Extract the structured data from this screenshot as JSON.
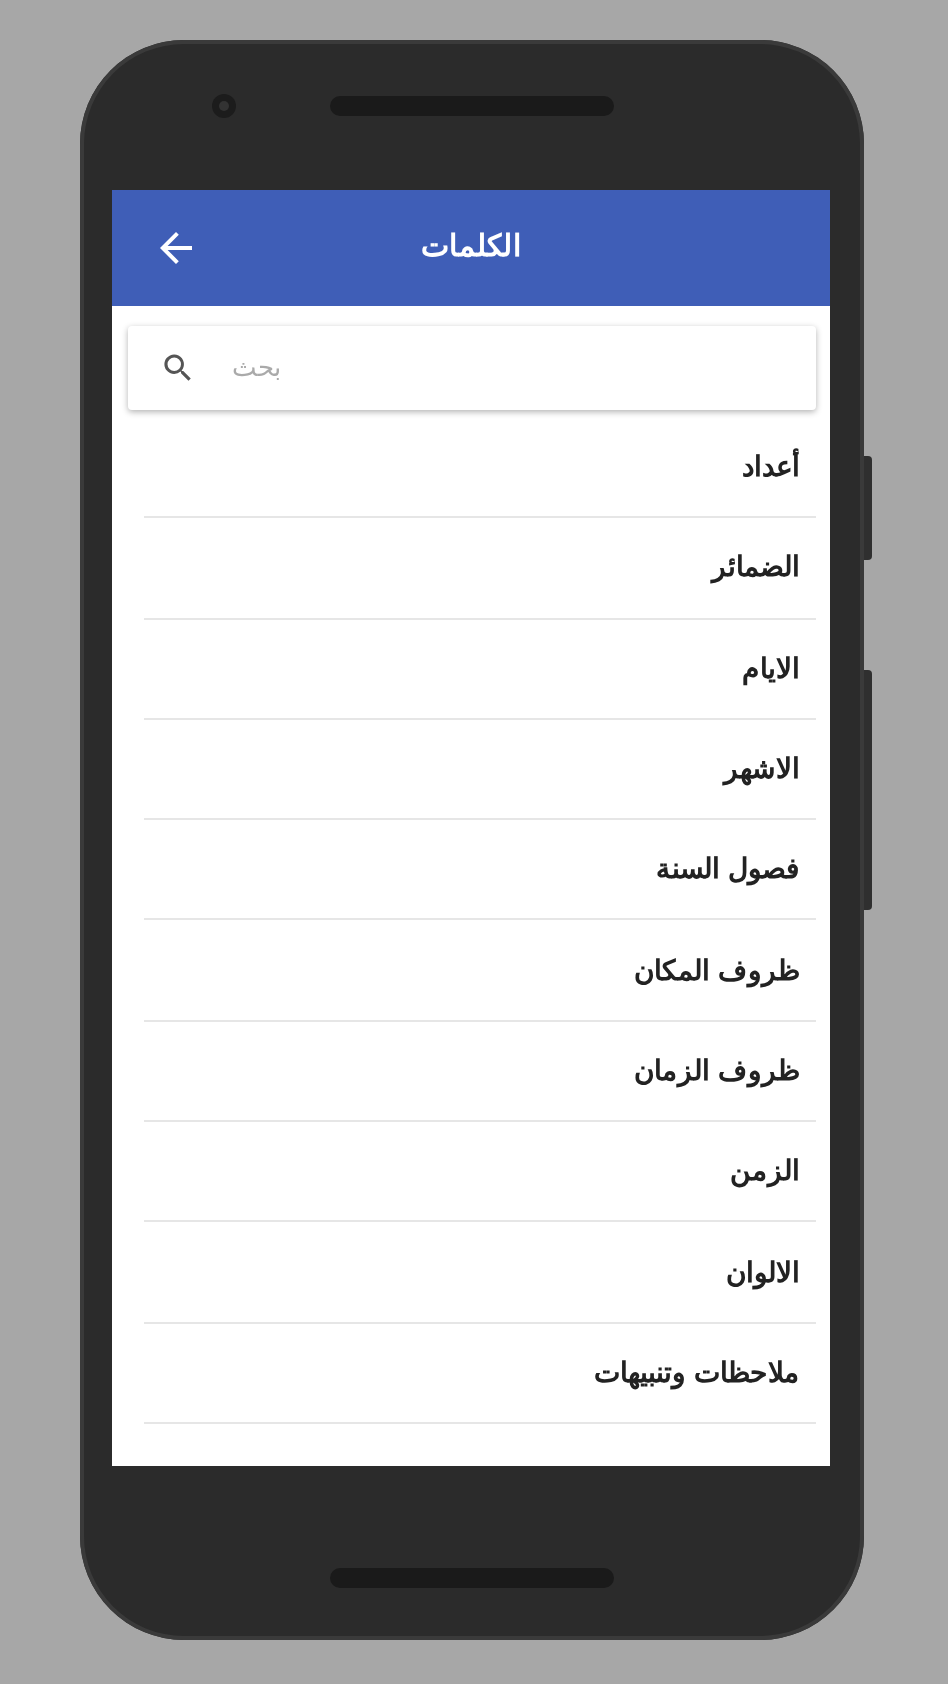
{
  "app_bar": {
    "title": "الكلمات"
  },
  "search": {
    "placeholder": "بحث"
  },
  "items": [
    {
      "label": "أعداد"
    },
    {
      "label": "الضمائر"
    },
    {
      "label": "الايام"
    },
    {
      "label": "الاشهر"
    },
    {
      "label": "فصول السنة"
    },
    {
      "label": "ظروف المكان"
    },
    {
      "label": "ظروف الزمان"
    },
    {
      "label": "الزمن"
    },
    {
      "label": "الالوان"
    },
    {
      "label": "ملاحظات وتنبيهات"
    }
  ]
}
